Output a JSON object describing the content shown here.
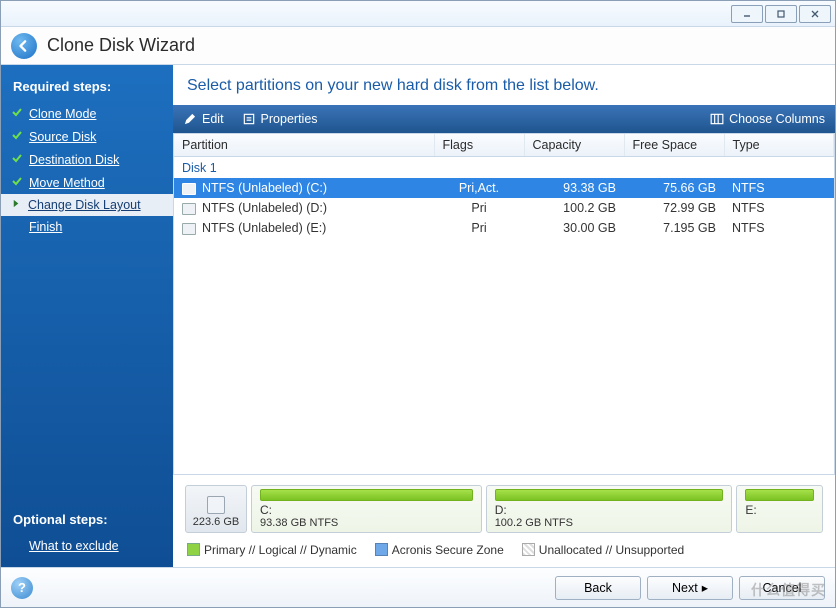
{
  "window": {
    "title": "Clone Disk Wizard"
  },
  "sidebar": {
    "required_heading": "Required steps:",
    "optional_heading": "Optional steps:",
    "steps": [
      {
        "label": "Clone Mode",
        "state": "done"
      },
      {
        "label": "Source Disk",
        "state": "done"
      },
      {
        "label": "Destination Disk",
        "state": "done"
      },
      {
        "label": "Move Method",
        "state": "done"
      },
      {
        "label": "Change Disk Layout",
        "state": "active"
      },
      {
        "label": "Finish",
        "state": "pending"
      }
    ],
    "optional": [
      {
        "label": "What to exclude"
      }
    ]
  },
  "main": {
    "instruction": "Select partitions on your new hard disk from the list below.",
    "toolbar": {
      "edit": "Edit",
      "properties": "Properties",
      "choose_columns": "Choose Columns"
    },
    "columns": {
      "partition": "Partition",
      "flags": "Flags",
      "capacity": "Capacity",
      "free": "Free Space",
      "type": "Type"
    },
    "disk_group": "Disk 1",
    "rows": [
      {
        "name": "NTFS (Unlabeled) (C:)",
        "flags": "Pri,Act.",
        "capacity": "93.38 GB",
        "free": "75.66 GB",
        "type": "NTFS",
        "selected": true
      },
      {
        "name": "NTFS (Unlabeled) (D:)",
        "flags": "Pri",
        "capacity": "100.2 GB",
        "free": "72.99 GB",
        "type": "NTFS",
        "selected": false
      },
      {
        "name": "NTFS (Unlabeled) (E:)",
        "flags": "Pri",
        "capacity": "30.00 GB",
        "free": "7.195 GB",
        "type": "NTFS",
        "selected": false
      }
    ],
    "diskbar": {
      "total": "223.6 GB",
      "parts": [
        {
          "name": "C:",
          "info": "93.38 GB  NTFS",
          "flex": 93
        },
        {
          "name": "D:",
          "info": "100.2 GB  NTFS",
          "flex": 100
        },
        {
          "name": "E:",
          "info": "",
          "flex": 30
        }
      ]
    },
    "legend": {
      "primary": "Primary // Logical // Dynamic",
      "secure": "Acronis Secure Zone",
      "unalloc": "Unallocated // Unsupported"
    }
  },
  "footer": {
    "back": "Back",
    "next": "Next",
    "cancel": "Cancel"
  },
  "watermark": "什么值得买"
}
